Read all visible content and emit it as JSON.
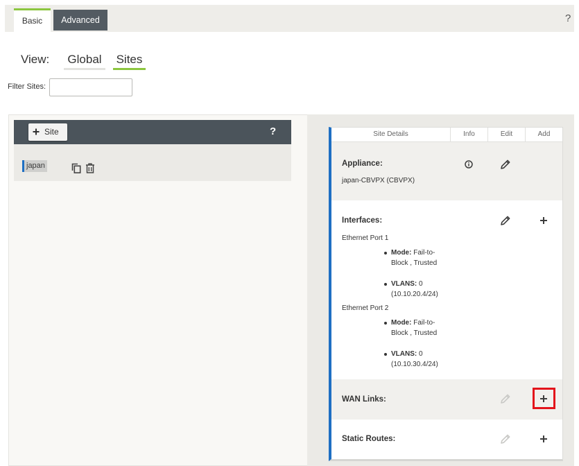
{
  "tabs": {
    "basic": "Basic",
    "advanced": "Advanced",
    "help": "?"
  },
  "view": {
    "label": "View:",
    "options": [
      {
        "label": "Global",
        "active": false
      },
      {
        "label": "Sites",
        "active": true
      }
    ]
  },
  "filter": {
    "label": "Filter Sites:",
    "value": ""
  },
  "sites_panel": {
    "add_site_icon": "plus-icon",
    "add_site_label": "Site",
    "help": "?",
    "sites": [
      {
        "name": "japan",
        "selected": true,
        "action_icons": [
          "copy-icon",
          "trash-icon"
        ]
      }
    ]
  },
  "site_details": {
    "columns": {
      "details": "Site Details",
      "info": "Info",
      "edit": "Edit",
      "add": "Add"
    },
    "appliance": {
      "label": "Appliance:",
      "value": "japan-CBVPX (CBVPX)",
      "info_icon": "info-circle-icon",
      "edit_icon": "pencil-icon",
      "edit_enabled": true,
      "add_highlighted": false
    },
    "interfaces": {
      "label": "Interfaces:",
      "edit_icon": "pencil-icon",
      "add_icon": "plus-icon",
      "edit_enabled": true,
      "add_highlighted": false,
      "ports": [
        {
          "name": "Ethernet Port 1",
          "mode_label": "Mode:",
          "mode_value": "Fail-to-Block , Trusted",
          "vlans_label": "VLANS:",
          "vlans_value": "0",
          "vlans_ip": "(10.10.20.4/24)"
        },
        {
          "name": "Ethernet Port 2",
          "mode_label": "Mode:",
          "mode_value": "Fail-to-Block , Trusted",
          "vlans_label": "VLANS:",
          "vlans_value": "0",
          "vlans_ip": "(10.10.30.4/24)"
        }
      ]
    },
    "wan_links": {
      "label": "WAN Links:",
      "edit_icon": "pencil-icon",
      "add_icon": "plus-icon",
      "edit_enabled": false,
      "add_highlighted": true
    },
    "static_routes": {
      "label": "Static Routes:",
      "edit_icon": "pencil-icon",
      "add_icon": "plus-icon",
      "edit_enabled": false,
      "add_highlighted": false
    }
  },
  "colors": {
    "accent_green": "#8cc63f",
    "tab_dark": "#535b62",
    "panel_header_dark": "#4b545b",
    "selected_blue": "#1e6fc3",
    "highlight_red": "#e3141b",
    "disabled_icon": "#c9c9c6"
  }
}
